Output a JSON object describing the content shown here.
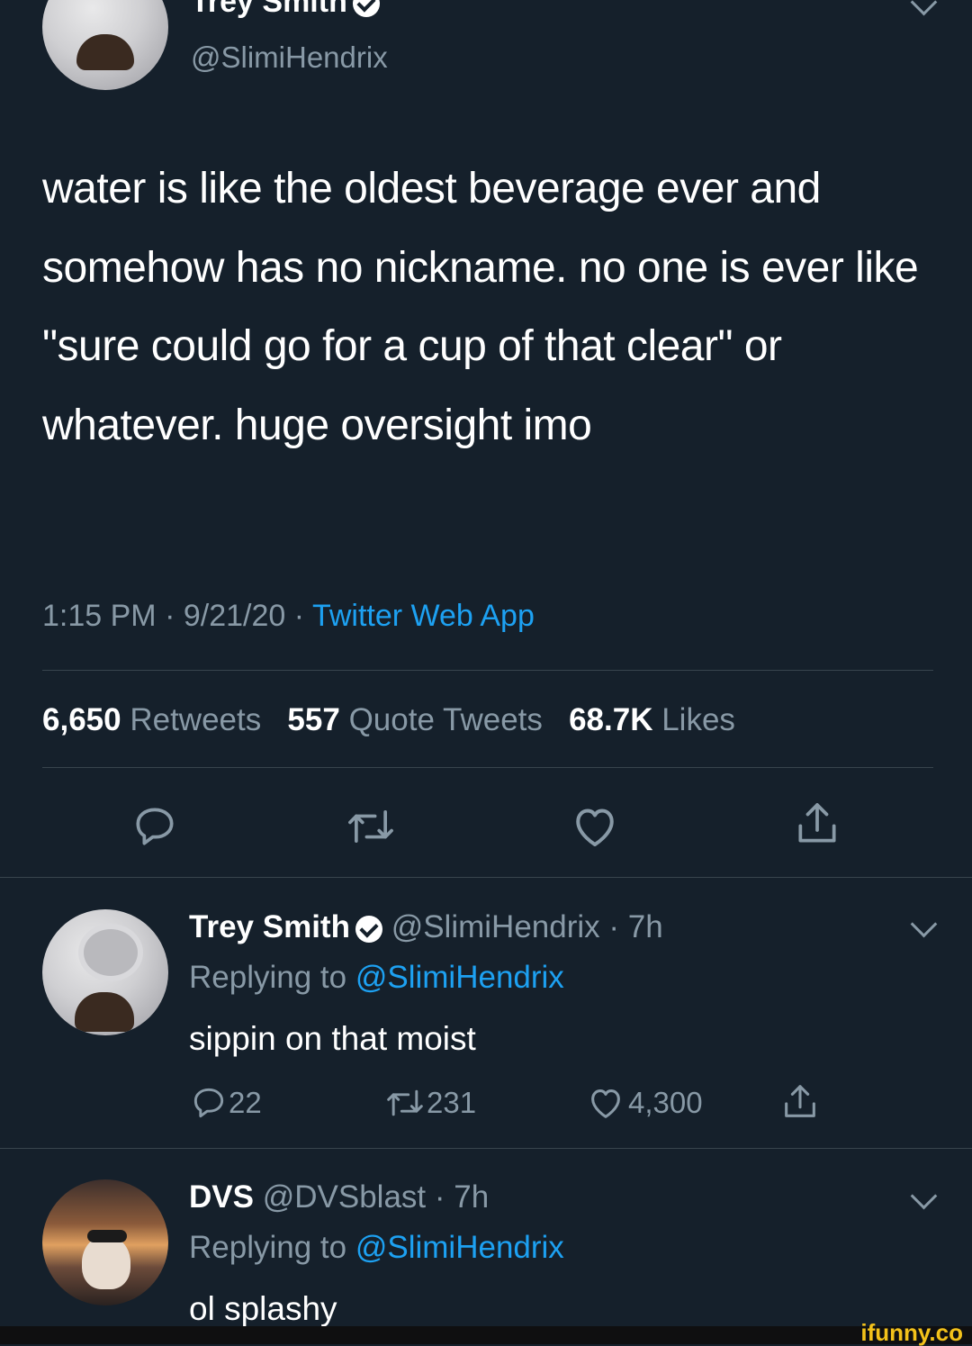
{
  "tweet": {
    "display_name": "Trey Smith",
    "handle": "@SlimiHendrix",
    "text": "water is like the oldest beverage ever and somehow has no nickname. no one is ever like \"sure could go for a cup of that clear\" or whatever. huge oversight imo",
    "time": "1:15 PM",
    "date": "9/21/20",
    "sep": "·",
    "source": "Twitter Web App",
    "retweets_count": "6,650",
    "retweets_label": "Retweets",
    "quotes_count": "557",
    "quotes_label": "Quote Tweets",
    "likes_count": "68.7K",
    "likes_label": "Likes"
  },
  "replies": [
    {
      "display_name": "Trey Smith",
      "handle": "@SlimiHendrix",
      "time_ago": "· 7h",
      "replying_prefix": "Replying to",
      "replying_to": "@SlimiHendrix",
      "text": "sippin on that moist",
      "reply_count": "22",
      "retweet_count": "231",
      "like_count": "4,300"
    },
    {
      "display_name": "DVS",
      "handle": "@DVSblast",
      "time_ago": "· 7h",
      "replying_prefix": "Replying to",
      "replying_to": "@SlimiHendrix",
      "text": "ol splashy"
    }
  ],
  "watermark": "ifunny.co",
  "colors": {
    "background": "#15202b",
    "accent": "#1da1f2",
    "muted": "#8899a6"
  }
}
